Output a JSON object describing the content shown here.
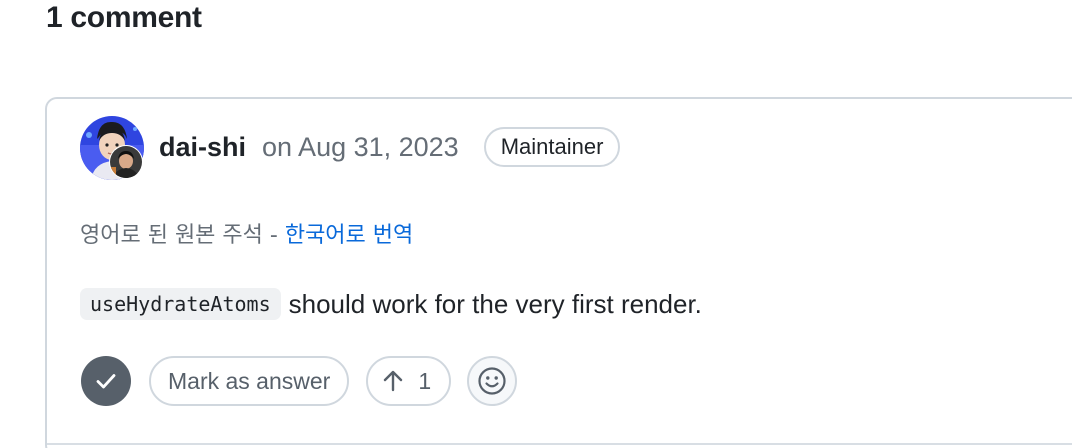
{
  "heading": "1 comment",
  "comment": {
    "author": "dai-shi",
    "date": "on Aug 31, 2023",
    "role": "Maintainer",
    "avatar_icon": "user-avatar",
    "translation": {
      "note": "영어로 된 원본 주석 - ",
      "link": "한국어로 번역"
    },
    "body": {
      "code": "useHydrateAtoms",
      "text": "should work for the very first render."
    },
    "actions": {
      "answer_icon": "check-icon",
      "mark_answer_label": "Mark as answer",
      "upvote_icon": "arrow-up-icon",
      "upvote_count": "1",
      "reaction_icon": "smiley-icon"
    }
  },
  "colors": {
    "link": "#0969da",
    "muted": "#656d76",
    "border": "#d0d7de",
    "check_bg": "#57606a"
  }
}
